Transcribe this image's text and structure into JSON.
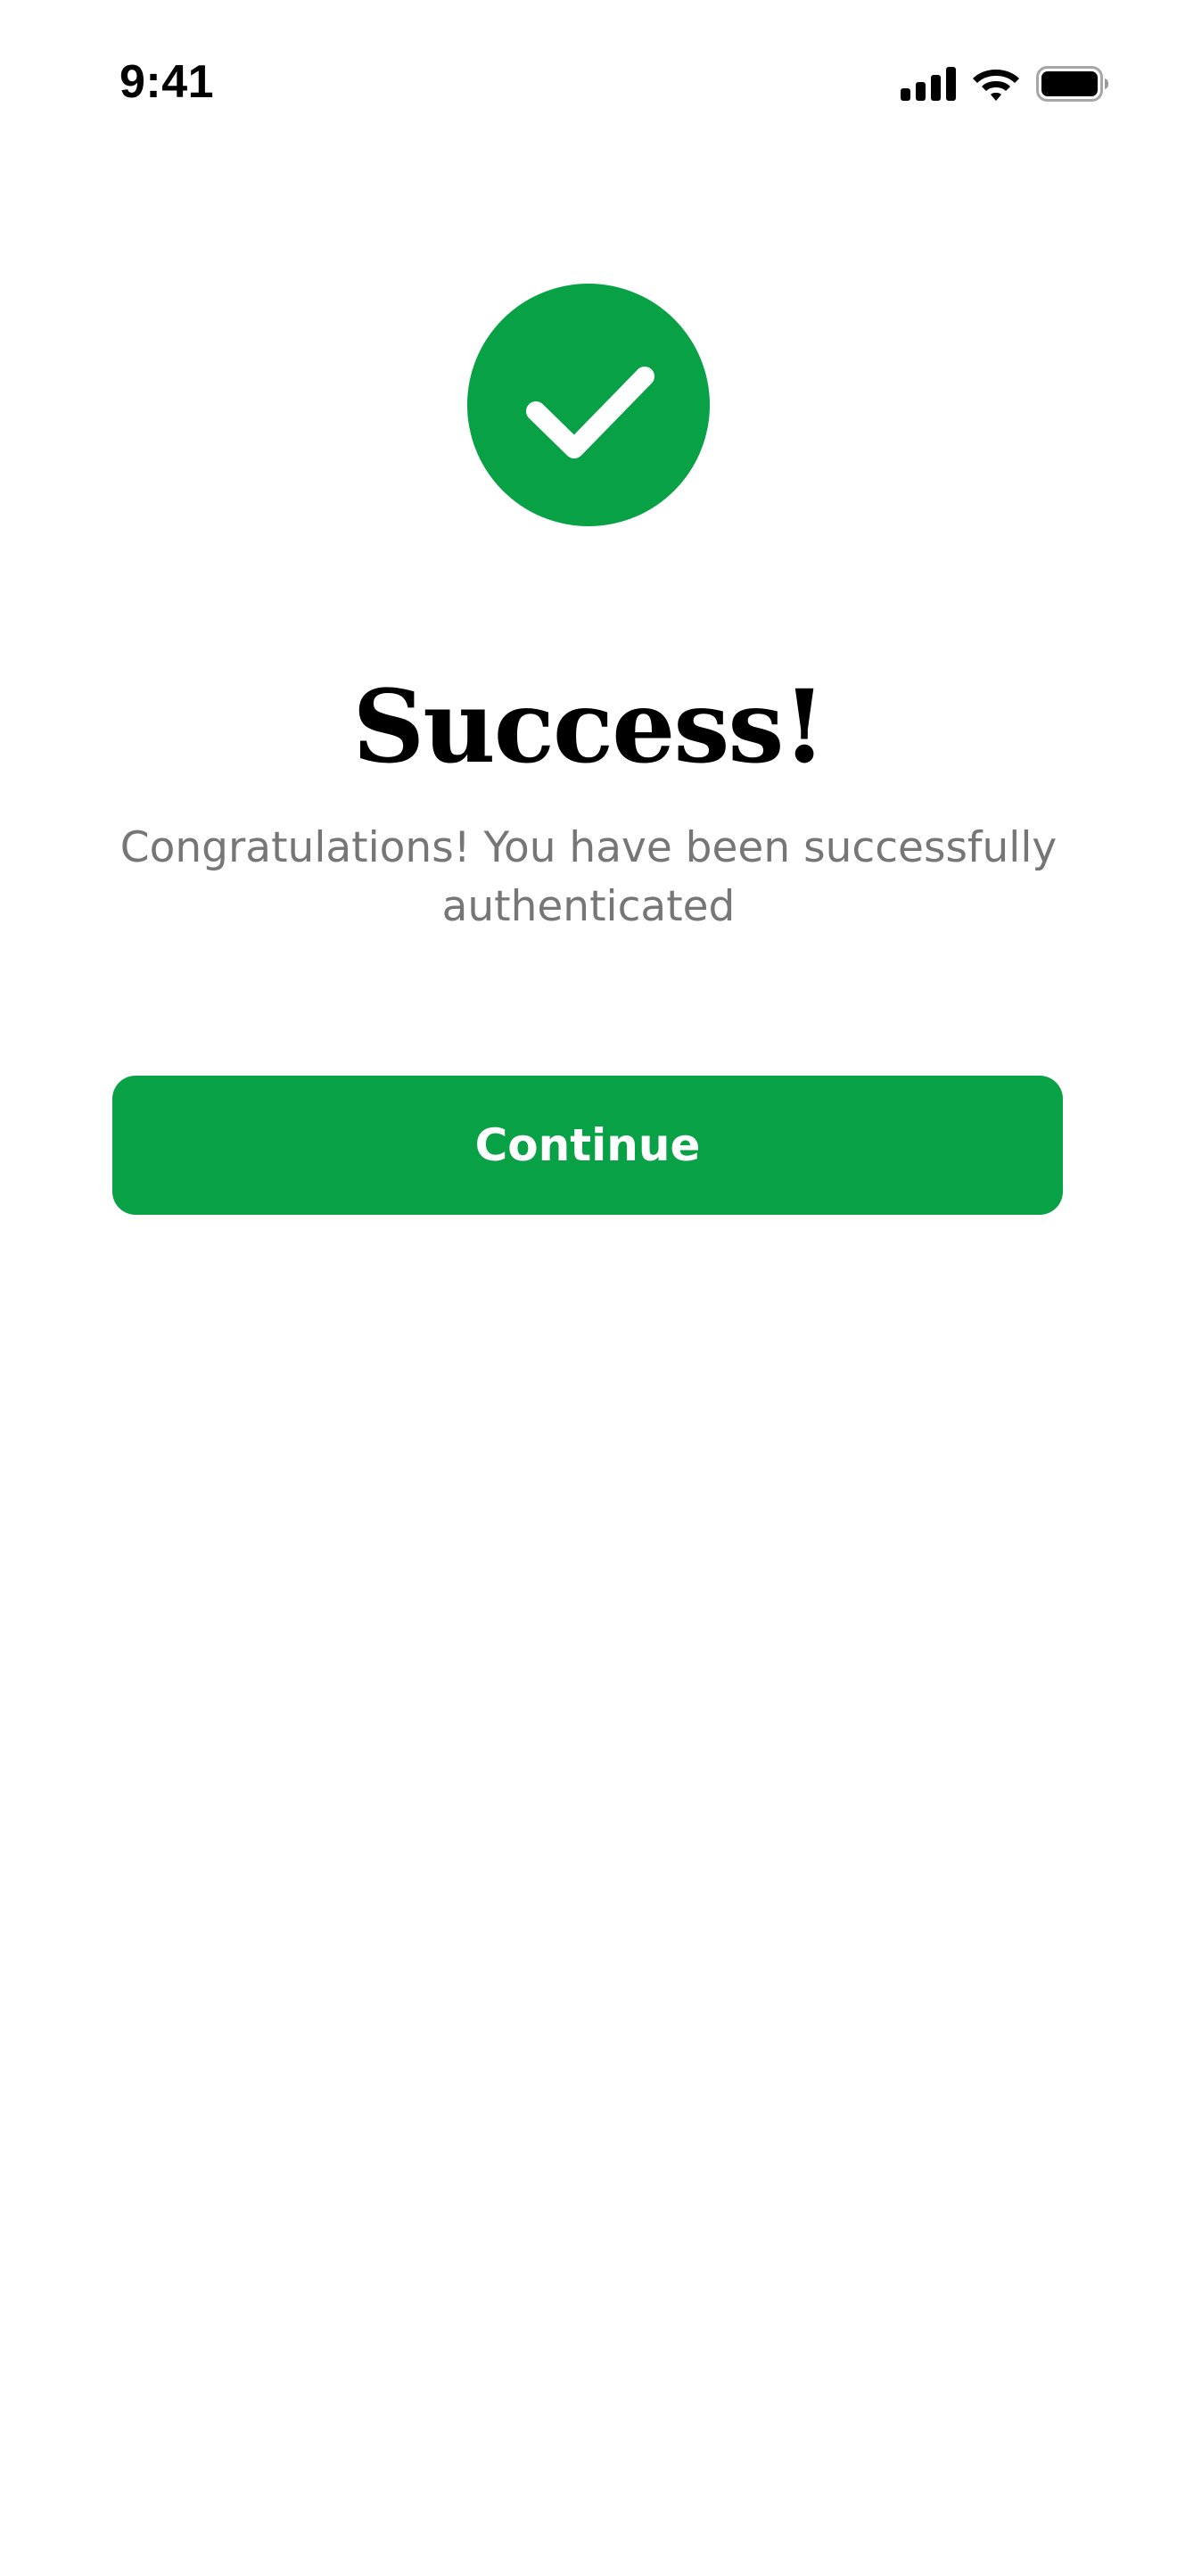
{
  "status_bar": {
    "time": "9:41",
    "icons": [
      "cellular-signal-icon",
      "wifi-icon",
      "battery-icon"
    ]
  },
  "success_icon": {
    "name": "checkmark-icon",
    "color": "#09A145"
  },
  "title": "Success!",
  "subtitle": "Congratulations! You have been successfully authenticated",
  "continue_button": {
    "label": "Continue",
    "color": "#09A145"
  },
  "colors": {
    "accent": "#09A145",
    "text_primary": "#000000",
    "text_secondary": "#767676",
    "background": "#FFFFFF"
  }
}
